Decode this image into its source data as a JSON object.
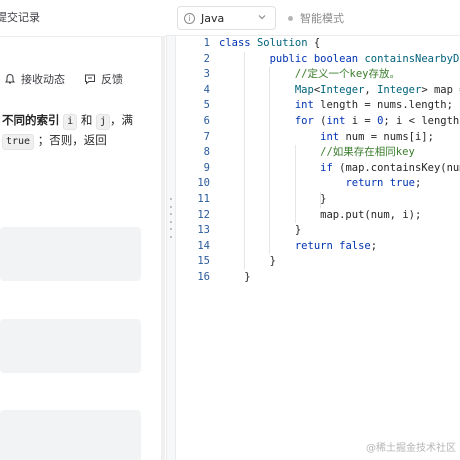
{
  "left_panel": {
    "tab_label": "提交记录",
    "actions": [
      {
        "label": "接收动态",
        "icon": "bell-icon"
      },
      {
        "label": "反馈",
        "icon": "feedback-icon"
      }
    ],
    "description": {
      "part1_bold": "不同的索引",
      "var_i": "i",
      "and": "和",
      "var_j": "j",
      "tail1": "，满",
      "true_chip": "true",
      "tail2": "；否则，返回"
    }
  },
  "toolbar": {
    "language": "Java",
    "smart_mode": "智能模式"
  },
  "editor": {
    "line_numbers": [
      "1",
      "2",
      "3",
      "4",
      "5",
      "6",
      "7",
      "8",
      "9",
      "10",
      "11",
      "12",
      "13",
      "14",
      "15",
      "16"
    ],
    "comments": {
      "c1": "//定义一个key存放。",
      "c2": "//如果存在相同key"
    }
  },
  "watermark": "@稀土掘金技术社区",
  "colors": {
    "keyword": "#0033b3",
    "type": "#00627a",
    "line_number": "#2b5b9c",
    "placeholder": "#f2f3f5"
  }
}
